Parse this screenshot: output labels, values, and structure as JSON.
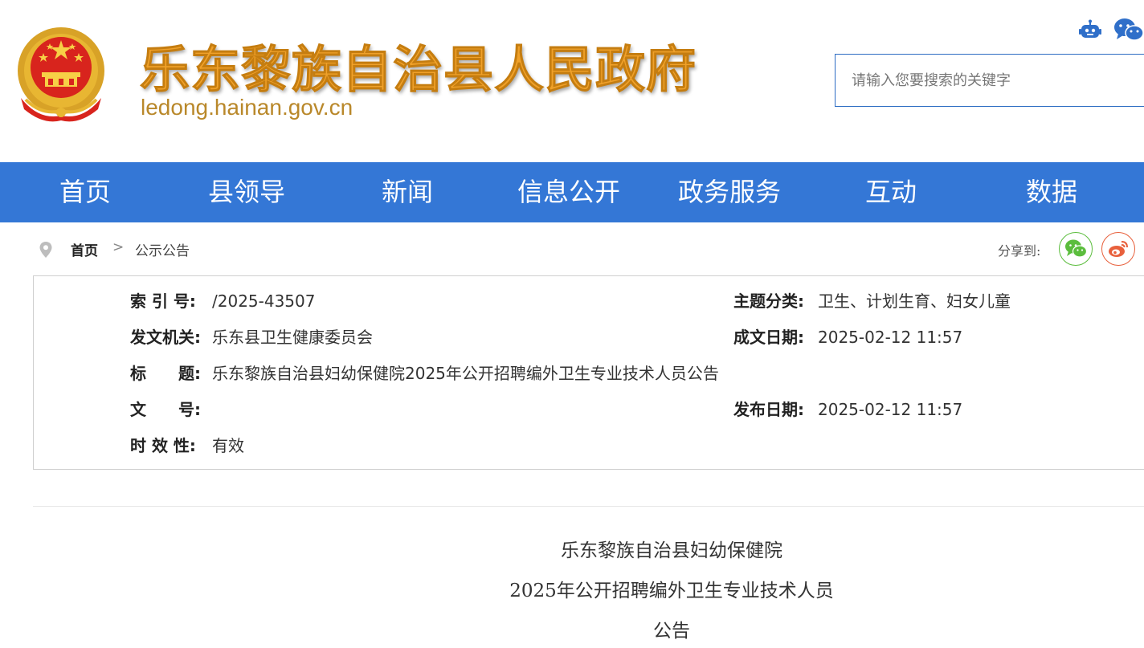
{
  "header": {
    "site_title": "乐东黎族自治县人民政府",
    "site_domain": "ledong.hainan.gov.cn",
    "search_placeholder": "请输入您要搜索的关键字",
    "icons": [
      "robot-icon",
      "wechat-icon"
    ]
  },
  "nav": {
    "items": [
      "首页",
      "县领导",
      "新闻",
      "信息公开",
      "政务服务",
      "互动",
      "数据"
    ]
  },
  "breadcrumb": {
    "home": "首页",
    "separator": ">",
    "current": "公示公告"
  },
  "share": {
    "label": "分享到:",
    "icons": [
      "wechat-icon",
      "weibo-icon"
    ]
  },
  "meta": {
    "index_label": "索 引 号:",
    "index_value": "/2025-43507",
    "topic_label": "主题分类:",
    "topic_value": "卫生、计划生育、妇女儿童",
    "issuer_label": "发文机关:",
    "issuer_value": "乐东县卫生健康委员会",
    "created_label": "成文日期:",
    "created_value": "2025-02-12 11:57",
    "title_label": "标　　题:",
    "title_value": "乐东黎族自治县妇幼保健院2025年公开招聘编外卫生专业技术人员公告",
    "docno_label": "文　　号:",
    "docno_value": "",
    "published_label": "发布日期:",
    "published_value": "2025-02-12 11:57",
    "validity_label": "时 效 性:",
    "validity_value": "有效"
  },
  "article": {
    "heading_lines": [
      "乐东黎族自治县妇幼保健院",
      "2025年公开招聘编外卫生专业技术人员",
      "公告"
    ]
  },
  "colors": {
    "nav_bg": "#3477d6",
    "title_gold": "#f0a12a",
    "domain_gold": "#b9882a",
    "search_border": "#2d6dc3"
  }
}
